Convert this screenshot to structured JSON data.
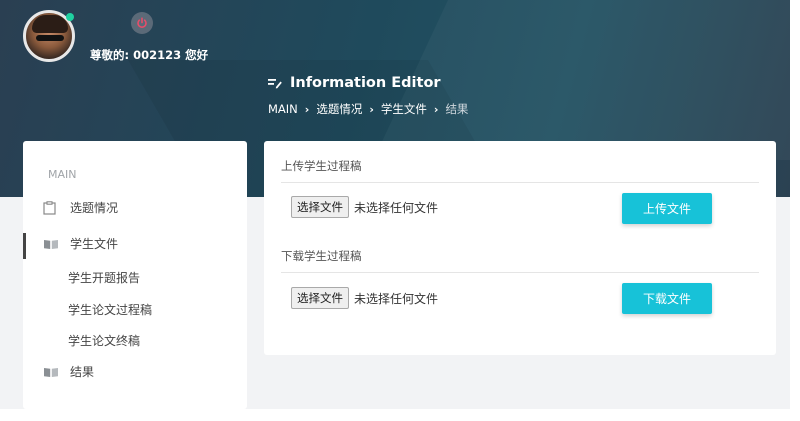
{
  "header": {
    "greeting": "尊敬的: 002123 您好",
    "page_title": "Information Editor",
    "breadcrumb": [
      "MAIN",
      "选题情况",
      "学生文件",
      "结果"
    ]
  },
  "sidebar": {
    "section_label": "MAIN",
    "items": [
      {
        "label": "选题情况",
        "icon": "clipboard-icon"
      },
      {
        "label": "学生文件",
        "icon": "book-icon",
        "active": true,
        "children": [
          "学生开题报告",
          "学生论文过程稿",
          "学生论文终稿"
        ]
      },
      {
        "label": "结果",
        "icon": "book-icon"
      }
    ]
  },
  "upload": {
    "title": "上传学生过程稿",
    "choose_label": "选择文件",
    "no_file_text": "未选择任何文件",
    "button_label": "上传文件"
  },
  "download": {
    "title": "下载学生过程稿",
    "choose_label": "选择文件",
    "no_file_text": "未选择任何文件",
    "button_label": "下载文件"
  },
  "colors": {
    "accent": "#17c2d8",
    "online": "#1fd1a1",
    "power": "#e84d6a"
  }
}
